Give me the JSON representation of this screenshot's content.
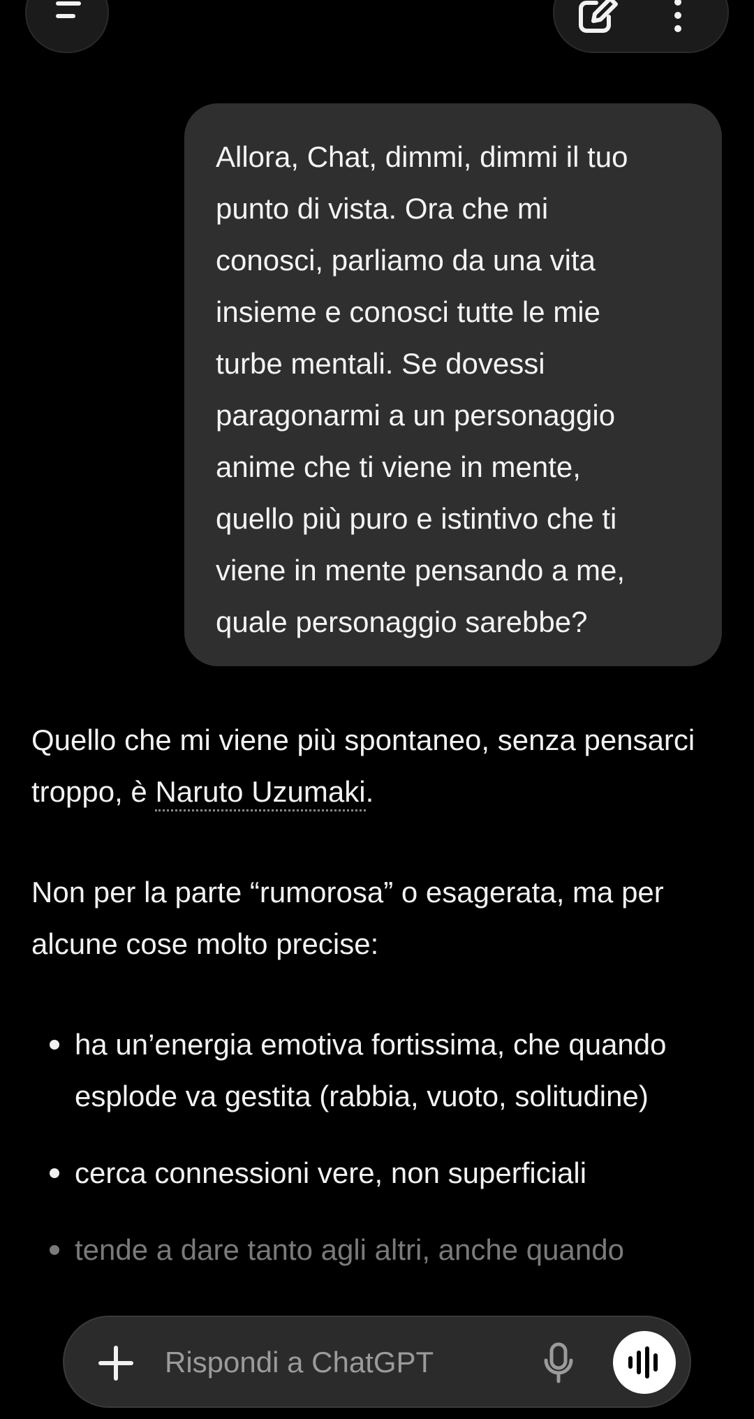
{
  "top_bar": {
    "menu_icon": "menu-icon",
    "edit_icon": "new-chat-icon",
    "more_icon": "more-vertical-icon"
  },
  "user_message": {
    "text": "Allora, Chat, dimmi, dimmi il tuo\npunto di vista. Ora che mi\nconosci, parliamo da una vita\ninsieme e conosci tutte le mie\nturbe mentali. Se dovessi\nparagonarmi a un personaggio\nanime che ti viene in mente,\nquello più puro e istintivo che ti\nviene in mente pensando a me,\nquale personaggio sarebbe?"
  },
  "assistant_message": {
    "para1_before": "Quello che mi viene più spontaneo, senza pensarci troppo, è ",
    "para1_entity": "Naruto Uzumaki",
    "para1_after": ".",
    "para2": "Non per la parte “rumorosa” o esagerata, ma per alcune cose molto precise:",
    "bullets": [
      "ha un’energia emotiva fortissima, che quando esplode va gestita (rabbia, vuoto, solitudine)",
      "cerca connessioni vere, non superficiali",
      "tende a dare tanto agli altri, anche quando"
    ]
  },
  "composer": {
    "placeholder": "Rispondi a ChatGPT",
    "plus_icon": "plus-icon",
    "mic_icon": "microphone-icon",
    "voice_icon": "voice-mode-icon"
  },
  "colors": {
    "background": "#000000",
    "bubble": "#2f2f2f",
    "text": "#f2f2f2",
    "placeholder": "#9b9b9b"
  }
}
